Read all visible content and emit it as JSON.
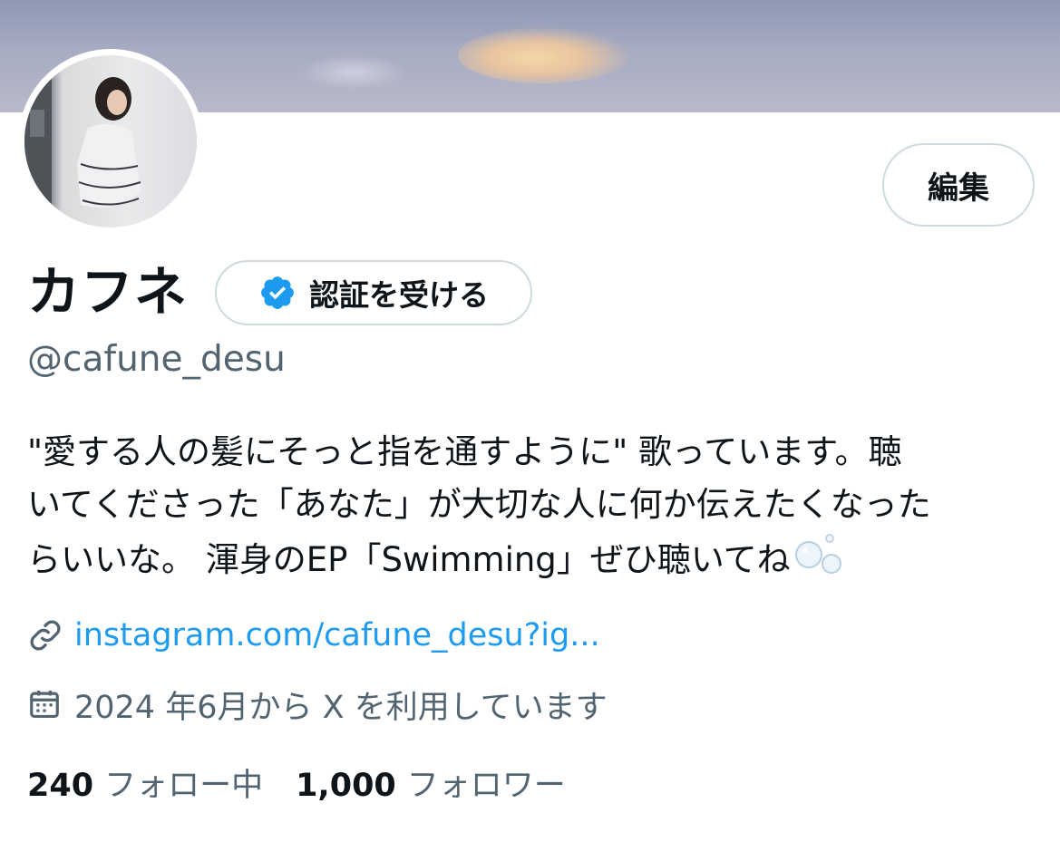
{
  "profile": {
    "display_name": "カフネ",
    "verify_button_label": "認証を受ける",
    "handle": "@cafune_desu",
    "edit_button_label": "編集",
    "bio_lines": [
      "\"愛する人の髪にそっと指を通すように\" 歌っています。聴",
      "いてくださった「あなた」が大切な人に何か伝えたくなった",
      "らいいな。 渾身のEP「Swimming」ぜひ聴いてね"
    ],
    "bio_emoji": "bubbles",
    "link": "instagram.com/cafune_desu?ig...",
    "joined": "2024 年6月から X を利用しています"
  },
  "stats": {
    "following_count": "240",
    "following_label": "フォロー中",
    "followers_count": "1,000",
    "followers_label": "フォロワー"
  },
  "icons": {
    "verified": "verified-badge-icon",
    "link": "link-icon",
    "calendar": "calendar-icon"
  },
  "colors": {
    "accent": "#1d9bf0",
    "muted_text": "#536471",
    "border": "#cfd9de"
  }
}
